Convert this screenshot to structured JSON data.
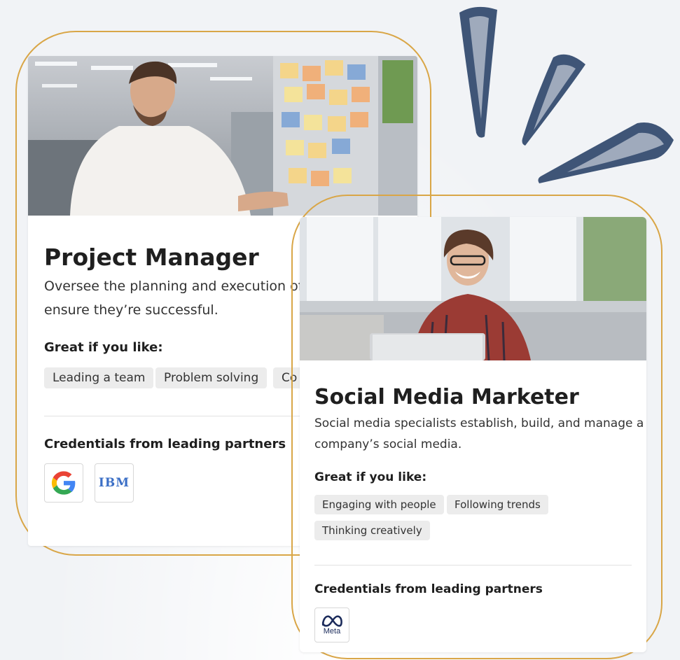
{
  "cards": [
    {
      "title": "Project Manager",
      "description_line1": "Oversee the planning and execution of",
      "description_line2": "ensure they’re successful.",
      "great_if_label": "Great if you like:",
      "chips": [
        "Leading a team",
        "Problem solving",
        "Co"
      ],
      "credentials_label": "Credentials from leading partners",
      "partners": [
        {
          "name": "Google",
          "icon": "google-logo-icon"
        },
        {
          "name": "IBM",
          "icon": "ibm-logo-icon",
          "text": "IBM"
        }
      ]
    },
    {
      "title": "Social Media Marketer",
      "description_line1": "Social media specialists establish, build, and manage a",
      "description_line2": "company’s social media.",
      "great_if_label": "Great if you like:",
      "chips": [
        "Engaging with people",
        "Following trends",
        "Thinking creatively"
      ],
      "credentials_label": "Credentials from leading partners",
      "partners": [
        {
          "name": "Meta",
          "icon": "meta-logo-icon",
          "text": "Meta"
        }
      ]
    }
  ],
  "colors": {
    "frame": "#d9a647",
    "doodle": "#3f5577",
    "chip": "#ececec",
    "background": "#f1f3f6"
  }
}
